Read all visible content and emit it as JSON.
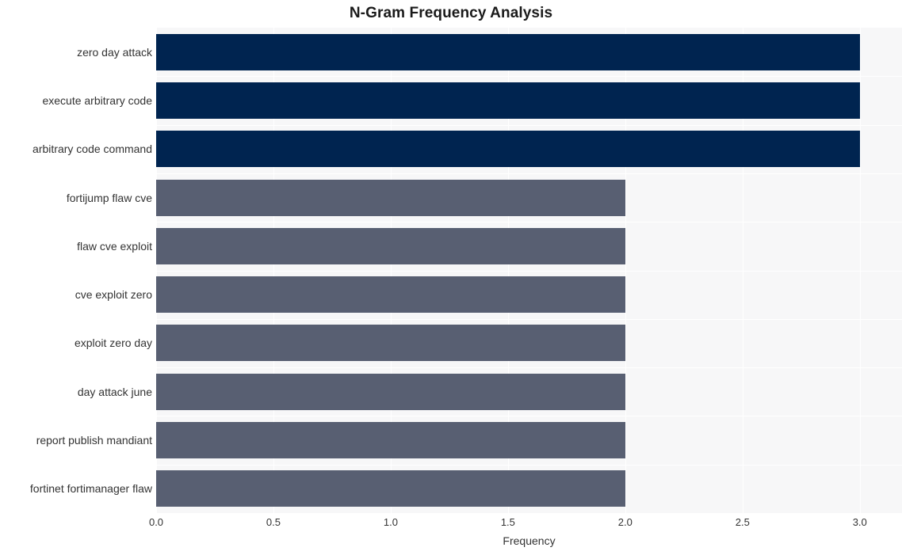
{
  "chart_data": {
    "type": "bar",
    "orientation": "horizontal",
    "title": "N-Gram Frequency Analysis",
    "xlabel": "Frequency",
    "ylabel": "",
    "categories": [
      "zero day attack",
      "execute arbitrary code",
      "arbitrary code command",
      "fortijump flaw cve",
      "flaw cve exploit",
      "cve exploit zero",
      "exploit zero day",
      "day attack june",
      "report publish mandiant",
      "fortinet fortimanager flaw"
    ],
    "values": [
      3,
      3,
      3,
      2,
      2,
      2,
      2,
      2,
      2,
      2
    ],
    "bar_colors": [
      "#002450",
      "#002450",
      "#002450",
      "#585f72",
      "#585f72",
      "#585f72",
      "#585f72",
      "#585f72",
      "#585f72",
      "#585f72"
    ],
    "xlim": [
      0.0,
      3.18
    ],
    "xticks": [
      "0.0",
      "0.5",
      "1.0",
      "1.5",
      "2.0",
      "2.5",
      "3.0"
    ],
    "xtick_values": [
      0.0,
      0.5,
      1.0,
      1.5,
      2.0,
      2.5,
      3.0
    ],
    "grid": true,
    "grid_color": "#ffffff",
    "plot_background": "#f7f7f8",
    "figure_background": "#ffffff",
    "legend": null
  },
  "colors": {
    "accent_dark": "#002450",
    "accent_muted": "#585f72",
    "text": "#333333",
    "title_text": "#1a1a1a"
  }
}
